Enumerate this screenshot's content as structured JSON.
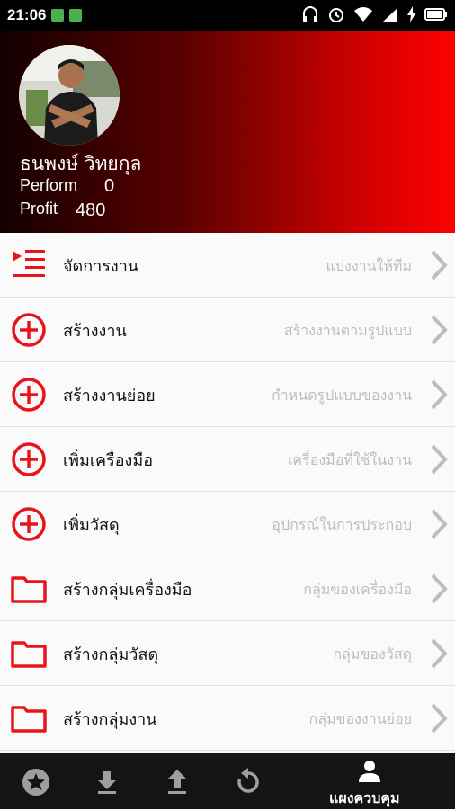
{
  "status_bar": {
    "time": "21:06"
  },
  "profile": {
    "name": "ธนพงษ์  วิทยกุล",
    "perform_label": "Perform",
    "perform_value": "0",
    "profit_label": "Profit",
    "profit_value": "480"
  },
  "menu": [
    {
      "icon": "task-list-icon",
      "label": "จัดการงาน",
      "sub": "แบ่งงานให้ทีม"
    },
    {
      "icon": "plus-circle-icon",
      "label": "สร้างงาน",
      "sub": "สร้างงานตามรูปแบบ"
    },
    {
      "icon": "plus-circle-icon",
      "label": "สร้างงานย่อย",
      "sub": "กำหนดรูปแบบของงาน"
    },
    {
      "icon": "plus-circle-icon",
      "label": "เพิ่มเครื่องมือ",
      "sub": "เครื่องมือที่ใช้ในงาน"
    },
    {
      "icon": "plus-circle-icon",
      "label": "เพิ่มวัสดุ",
      "sub": "อุปกรณ์ในการประกอบ"
    },
    {
      "icon": "folder-icon",
      "label": "สร้างกลุ่มเครื่องมือ",
      "sub": "กลุ่มของเครื่องมือ"
    },
    {
      "icon": "folder-icon",
      "label": "สร้างกลุ่มวัสดุ",
      "sub": "กลุ่มของวัสดุ"
    },
    {
      "icon": "folder-icon",
      "label": "สร้างกลุ่มงาน",
      "sub": "กลุ่มของงานย่อย"
    }
  ],
  "bottom_nav": {
    "tabs": [
      "star-icon",
      "download-icon",
      "upload-icon",
      "refresh-icon",
      "person-icon"
    ],
    "active_label": "แผงควบคุม"
  },
  "colors": {
    "accent": "#e8141b",
    "header_dark": "#140000",
    "header_bright": "#ff0000",
    "nav_bg": "#141414"
  }
}
